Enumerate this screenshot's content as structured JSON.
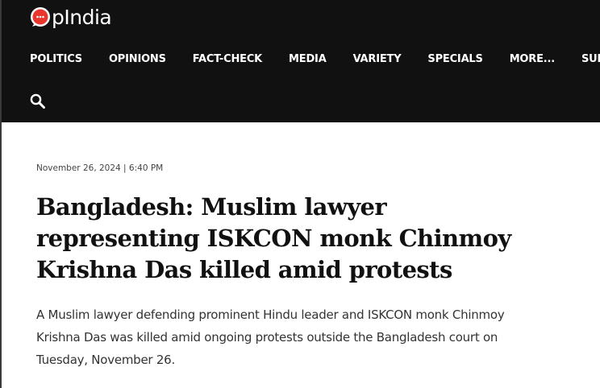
{
  "site": {
    "logo_text": "pIndia",
    "logo_icon": "chat-bubble-o-icon",
    "brand_color": "#e8362d"
  },
  "nav": {
    "items": [
      {
        "label": "POLITICS"
      },
      {
        "label": "OPINIONS"
      },
      {
        "label": "FACT-CHECK"
      },
      {
        "label": "MEDIA"
      },
      {
        "label": "VARIETY"
      },
      {
        "label": "SPECIALS"
      },
      {
        "label": "MORE..."
      },
      {
        "label": "SUPPO"
      }
    ],
    "search_icon": "search-icon"
  },
  "article": {
    "date": "November 26, 2024 | 6:40 PM",
    "headline": "Bangladesh: Muslim lawyer representing ISKCON monk Chinmoy Krishna Das killed amid protests",
    "summary": "A Muslim lawyer defending prominent Hindu leader and ISKCON monk Chinmoy Krishna Das was killed amid ongoing protests outside the Bangladesh court on Tuesday, November 26."
  },
  "colors": {
    "header_bg": "#111111",
    "headline": "#111111",
    "body_text": "#333333"
  }
}
